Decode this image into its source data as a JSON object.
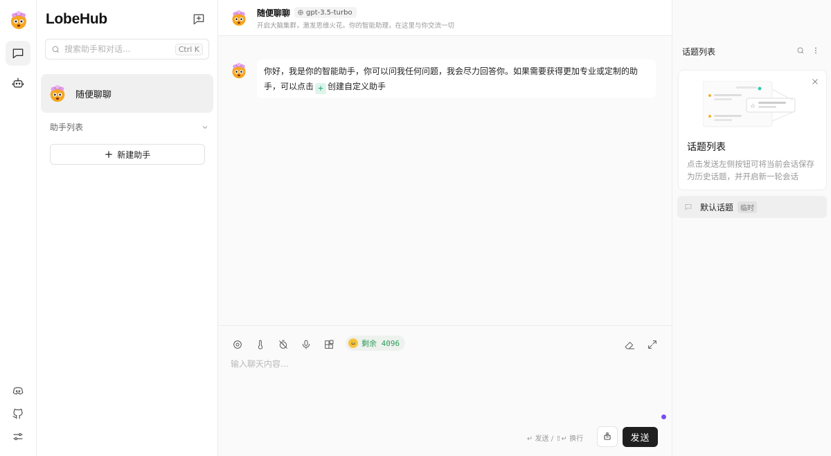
{
  "app": {
    "logo": "LobeHub"
  },
  "sessions": {
    "search_placeholder": "搜索助手和对话...",
    "search_shortcut": "Ctrl K",
    "active_session": "随便聊聊",
    "group_label": "助手列表",
    "add_agent_label": "新建助手"
  },
  "chat": {
    "title": "随便聊聊",
    "model": "gpt-3.5-turbo",
    "description": "开启大脑集群，激发思维火花。你的智能助理，在这里与你交流一切",
    "message_part1": "你好，我是你的智能助手，你可以问我任何问题，我会尽力回答你。如果需要获得更加专业或定制的助手，可以点击",
    "message_plus": "+",
    "message_part2": "创建自定义助手",
    "token_label": "剩余 4096",
    "input_placeholder": "输入聊天内容...",
    "hint": "↵ 发送 / ⇧↵ 换行",
    "send_label": "发送"
  },
  "topics": {
    "title": "话题列表",
    "guide_title": "话题列表",
    "guide_desc": "点击发送左侧按钮可将当前会话保存为历史话题，并开启新一轮会话",
    "default_topic": "默认话题",
    "default_topic_tag": "临时"
  },
  "icons": {
    "avatar": "exploding-head-emoji",
    "accent_purple": "#7b4df0",
    "send_bg": "#1f1f1f"
  }
}
